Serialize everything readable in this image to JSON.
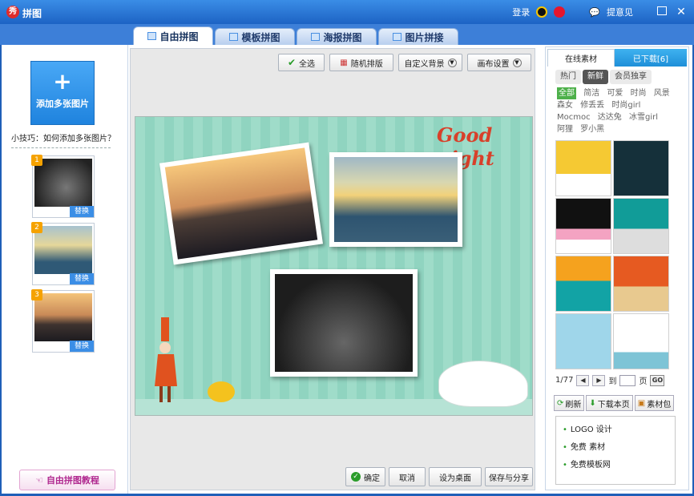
{
  "window": {
    "title": "拼图",
    "login": "登录",
    "feedback": "提意见"
  },
  "tabs": [
    {
      "label": "自由拼图",
      "active": true
    },
    {
      "label": "模板拼图",
      "active": false
    },
    {
      "label": "海报拼图",
      "active": false
    },
    {
      "label": "图片拼接",
      "active": false
    }
  ],
  "left": {
    "add_label": "添加多张图片",
    "tip": "小技巧：如何添加多张图片？",
    "thumbs": [
      {
        "num": "1",
        "replace": "替换"
      },
      {
        "num": "2",
        "replace": "替换"
      },
      {
        "num": "3",
        "replace": "替换"
      }
    ],
    "tutorial": "自由拼图教程"
  },
  "toolbar": {
    "select_all": "全选",
    "random": "随机排版",
    "custom_bg": "自定义背景",
    "canvas_settings": "画布设置"
  },
  "canvas": {
    "title_text": "Good night"
  },
  "bottom": {
    "ok": "确定",
    "cancel": "取消",
    "set_desktop": "设为桌面",
    "save_share": "保存与分享"
  },
  "right": {
    "tab_online": "在线素材",
    "tab_downloaded": "已下载[6]",
    "pills": [
      "热门",
      "新鲜",
      "会员独享"
    ],
    "selected_pill": "新鲜",
    "categories": [
      "全部",
      "简洁",
      "可爱",
      "时尚",
      "风景",
      "森女",
      "修丢丢",
      "时尚girl",
      "Mocmoc",
      "达达兔",
      "冰雪girl",
      "阿狸",
      "罗小黑"
    ],
    "page_text": "1/77",
    "to_label": "到",
    "page_label": "页",
    "go": "GO",
    "refresh": "刷新",
    "download_page": "下载本页",
    "material_pack": "素材包",
    "links": [
      "LOGO 设计",
      "免费 素材",
      "免费模板网"
    ]
  }
}
